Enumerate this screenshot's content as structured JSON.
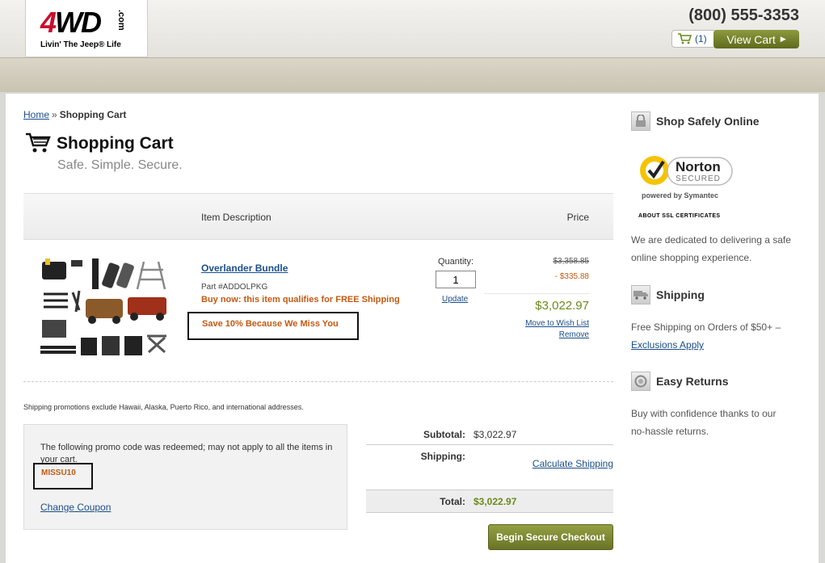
{
  "header": {
    "logo_main": "4WD",
    "logo_com": ".com",
    "logo_tagline": "Livin' The Jeep® Life",
    "phone": "(800) 555-3353",
    "cart_count": "(1)",
    "view_cart": "View Cart",
    "brand_color": "#c8102e"
  },
  "breadcrumb": {
    "home": "Home",
    "separator": "»",
    "current": "Shopping Cart"
  },
  "page": {
    "title": "Shopping Cart",
    "subtitle": "Safe. Simple. Secure."
  },
  "table": {
    "col_description": "Item Description",
    "col_price": "Price"
  },
  "item": {
    "name": "Overlander Bundle",
    "part": "Part #ADDOLPKG",
    "shipping_note": "Buy now: this item qualifies for FREE Shipping",
    "promo_text": "Save 10% Because We Miss You",
    "quantity_label": "Quantity:",
    "quantity": "1",
    "update": "Update",
    "original_price": "$3,358.85",
    "discount": "- $335.88",
    "final_price": "$3,022.97",
    "wishlist": "Move to Wish List",
    "remove": "Remove"
  },
  "shipping_exclusion_note": "Shipping promotions exclude Hawaii, Alaska, Puerto Rico, and international addresses.",
  "coupon": {
    "message": "The following promo code was redeemed; may not apply to all the items in your cart.",
    "code": "MISSU10",
    "change": "Change Coupon"
  },
  "totals": {
    "subtotal_label": "Subtotal:",
    "subtotal": "$3,022.97",
    "shipping_label": "Shipping:",
    "calc_shipping": "Calculate Shipping",
    "total_label": "Total:",
    "total": "$3,022.97",
    "checkout": "Begin Secure Checkout"
  },
  "sidebar": {
    "safe_heading": "Shop Safely Online",
    "norton_name": "Norton",
    "norton_secured": "SECURED",
    "norton_powered": "powered by Symantec",
    "ssl_link": "ABOUT SSL CERTIFICATES",
    "safe_text": "We are dedicated to delivering a safe online shopping experience.",
    "shipping_heading": "Shipping",
    "shipping_text": "Free Shipping on Orders of $50+ –",
    "shipping_link": "Exclusions Apply",
    "returns_heading": "Easy Returns",
    "returns_text": "Buy with confidence thanks to our no-hassle returns."
  }
}
